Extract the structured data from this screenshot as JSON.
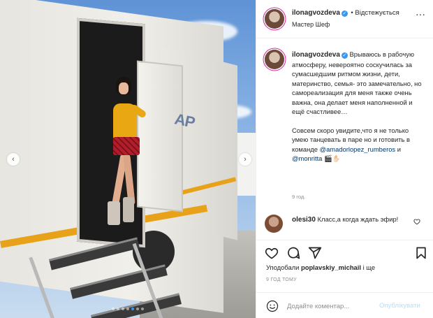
{
  "post": {
    "author": {
      "username": "ilonagvozdeva",
      "verified": true,
      "follow_label": "Відстежується",
      "subtitle": "Мастер Шеф"
    },
    "caption": {
      "paragraph1": "Врываюсь в рабочую атмосферу, невероятно соскучилась за сумасшедшим ритмом жизни, дети, материнство, семья- это замечательно, но самореализация для меня также очень важна, она делает меня наполненной и ещё счастливее…",
      "paragraph2_text": "Совсем скоро увидите,что я не только умею танцевать в паре но и готовить в команде",
      "mention1": "@amadorlopez_rumberos",
      "conjunction": " и",
      "mention2": "@monritta",
      "trailing_emoji": " 🎬✋🏻"
    },
    "age": "9 год.",
    "comment": {
      "username": "olesi30",
      "text": "Класс,а когда ждать эфир!"
    },
    "likes": {
      "prefix": "Уподобали",
      "user": "poplavskiy_michail",
      "suffix": "і ще"
    },
    "timestamp": "9 ГОД ТОМУ",
    "add_comment": {
      "placeholder": "Додайте коментар...",
      "post_label": "Опублікувати"
    },
    "carousel": {
      "count": 7,
      "active_index": 4
    },
    "photo_text": "AP"
  },
  "colors": {
    "link": "#00376b",
    "verified": "#3897f0",
    "post_button_disabled": "#b2dffc",
    "muted": "#8e8e8e"
  },
  "icons": [
    "more-icon",
    "verified-icon",
    "heart-icon",
    "comment-icon",
    "share-icon",
    "bookmark-icon",
    "emoji-icon",
    "chevron-left-icon",
    "chevron-right-icon"
  ]
}
